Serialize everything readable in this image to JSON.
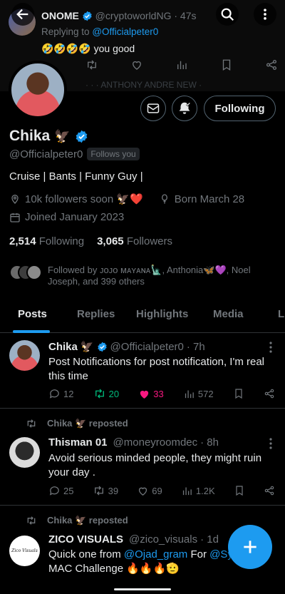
{
  "banner": {
    "name": "ONOME",
    "handle": "@cryptoworldNG",
    "time": "· 47s",
    "replying_to_prefix": "Replying to",
    "replying_to_handle": "@Officialpeter0",
    "text": "🤣🤣🤣🤣 you good",
    "peek": "· ·  · ANTHONY ANDRE NEW ·"
  },
  "profile": {
    "name": "Chika",
    "name_emoji": "🦅",
    "handle": "@Officialpeter0",
    "follows_you": "Follows you",
    "bio": "Cruise | Bants | Funny Guy |",
    "location": "10k followers soon 🦅❤️",
    "birthday": "Born March 28",
    "joined": "Joined January 2023",
    "following_count": "2,514",
    "following_label": "Following",
    "followers_count": "3,065",
    "followers_label": "Followers",
    "followed_by": "Followed by ᴊᴏᴊᴏ ᴍᴀʏᴀɴᴀ🗽, Anthonia🦋💜, Noel Joseph, and 399 others",
    "follow_button": "Following"
  },
  "tabs": [
    "Posts",
    "Replies",
    "Highlights",
    "Media",
    "L"
  ],
  "posts": [
    {
      "name": "Chika",
      "emoji": "🦅",
      "handle": "@Officialpeter0",
      "time": "· 7h",
      "text": "Post Notifications for post notification, I'm real this time",
      "replies": "12",
      "reposts": "20",
      "likes": "33",
      "views": "572"
    },
    {
      "repost_label": "Chika 🦅 reposted",
      "name": "Thisman 01",
      "handle": "@moneyroomdec",
      "time": "· 8h",
      "text": "Avoid serious minded people, they might ruin your day .",
      "replies": "25",
      "reposts": "39",
      "likes": "69",
      "views": "1.2K"
    },
    {
      "repost_label": "Chika 🦅 reposted",
      "name": "ZICO VISUALS",
      "handle": "@zico_visuals",
      "time": "· 1d",
      "text_prefix": "Quick one from ",
      "mention1": "@Ojad_gram",
      "text_mid": " For ",
      "mention2": "@Symp",
      "text_line2": "MAC Challenge 🔥🔥🔥🫡",
      "avatar_text": "Zico Visuals"
    }
  ],
  "colors": {
    "accent": "#1d9bf0",
    "like": "#f91880",
    "repost": "#00ba7c",
    "muted": "#71767b",
    "background": "#000000"
  }
}
